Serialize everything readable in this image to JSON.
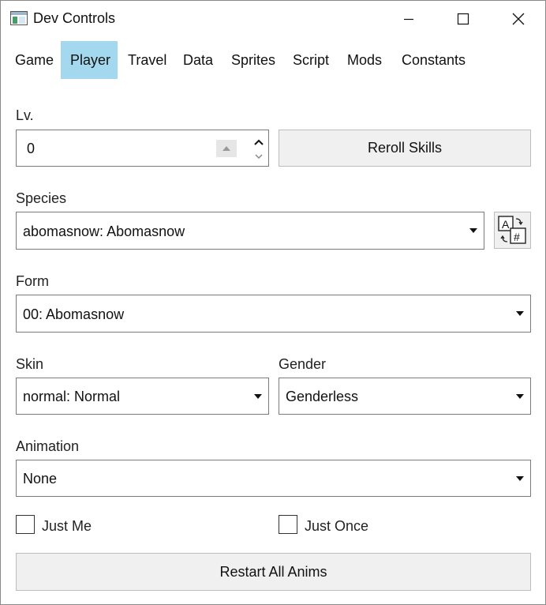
{
  "window": {
    "title": "Dev Controls"
  },
  "menu": {
    "items": [
      "Game",
      "Player",
      "Travel",
      "Data",
      "Sprites",
      "Script",
      "Mods",
      "Constants"
    ],
    "active": "Player"
  },
  "level": {
    "label": "Lv.",
    "value": "0"
  },
  "reroll_button": "Reroll Skills",
  "species": {
    "label": "Species",
    "selected": "abomasnow: Abomasnow"
  },
  "form": {
    "label": "Form",
    "selected": "00: Abomasnow"
  },
  "skin": {
    "label": "Skin",
    "selected": "normal: Normal"
  },
  "gender": {
    "label": "Gender",
    "selected": "Genderless"
  },
  "animation": {
    "label": "Animation",
    "selected": "None"
  },
  "checkboxes": [
    {
      "label": "Just Me",
      "checked": false
    },
    {
      "label": "Just Once",
      "checked": false
    }
  ],
  "restart_button": "Restart All Anims",
  "colors": {
    "active_tab": "#a3d8ef",
    "button_bg": "#f0f0f0",
    "border": "#7a7a7a"
  },
  "icons": {
    "app": "window-app-icon",
    "species_lookup": "text-to-number-icon",
    "minimize": "minimize-icon",
    "maximize": "maximize-icon",
    "close": "close-icon"
  }
}
